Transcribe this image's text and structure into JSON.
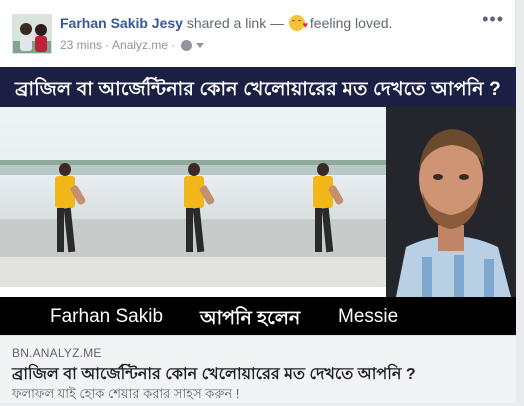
{
  "post": {
    "author": "Farhan Sakib Jesy",
    "action": "shared a link —",
    "feeling": "feeling loved.",
    "time": "23 mins",
    "separator": "·",
    "via": "Analyz.me",
    "privacy_icon": "globe-icon",
    "more_icon": "more-options-icon",
    "more_glyph": "•••"
  },
  "image": {
    "banner_text": "ব্রাজিল বা আর্জেন্টিনার কোন খেলোয়ারের মত দেখতে আপনি ?",
    "caption_left": "Farhan Sakib",
    "caption_middle": "আপনি হলেন",
    "caption_right": "Messie"
  },
  "link": {
    "domain": "BN.ANALYZ.ME",
    "title": "ব্রাজিল বা আর্জেন্টিনার কোন খেলোয়ারের মত দেখতে আপনি ?",
    "description": "ফলাফল যাই হোক শেয়ার করার সাহস করুন !"
  },
  "colors": {
    "author": "#365899",
    "banner_bg": "#1b1f44",
    "caption_bg": "#000000",
    "link_panel_bg": "#f2f3f5"
  }
}
